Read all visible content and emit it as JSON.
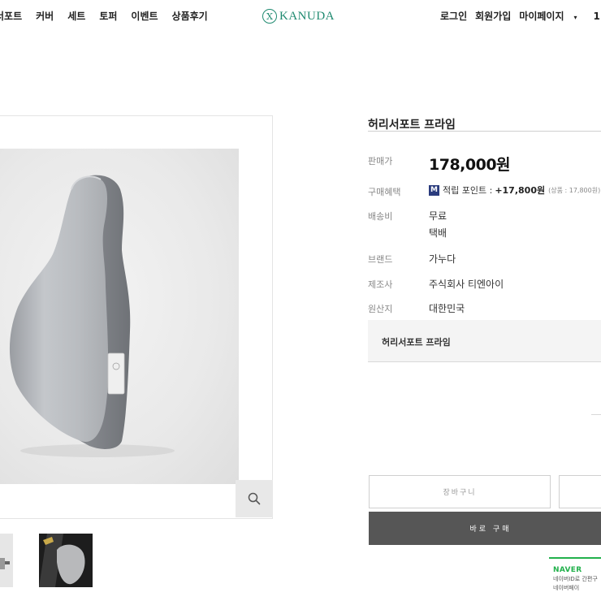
{
  "header": {
    "nav": [
      "서포트",
      "커버",
      "세트",
      "토퍼",
      "이벤트",
      "상품후기"
    ],
    "logo_text": "KANUDA",
    "logo_mark": "X",
    "util": {
      "login": "로그인",
      "join": "회원가입",
      "mypage": "마이페이지",
      "mypage_caret": "▾",
      "extra": "1"
    }
  },
  "product": {
    "title": "허리서포트 프라임",
    "rows": {
      "price_label": "판매가",
      "price_value": "178,000원",
      "benefit_label": "구매혜택",
      "benefit_badge": "M",
      "benefit_text": "적립 포인트 :",
      "benefit_amount": "+17,800원",
      "benefit_sub": "(상품 : 17,800원)",
      "shipping_label": "배송비",
      "shipping_value": "무료",
      "shipping_method": "택배",
      "brand_label": "브랜드",
      "brand_value": "가누다",
      "maker_label": "제조사",
      "maker_value": "주식회사 티엔아이",
      "origin_label": "원산지",
      "origin_value": "대한민국"
    },
    "option_title": "허리서포트 프라임"
  },
  "actions": {
    "cart": "장바구니",
    "buy": "바로 구매"
  },
  "naver": {
    "logo": "NAVER",
    "line1": "네이버ID로 간편구",
    "line2": "네이버페이"
  },
  "colors": {
    "brand": "#1f8a70",
    "buy_button": "#565656",
    "naver_green": "#22b14c",
    "benefit_badge": "#2a3b7d"
  },
  "icons": {
    "zoom": "magnifier-icon"
  }
}
